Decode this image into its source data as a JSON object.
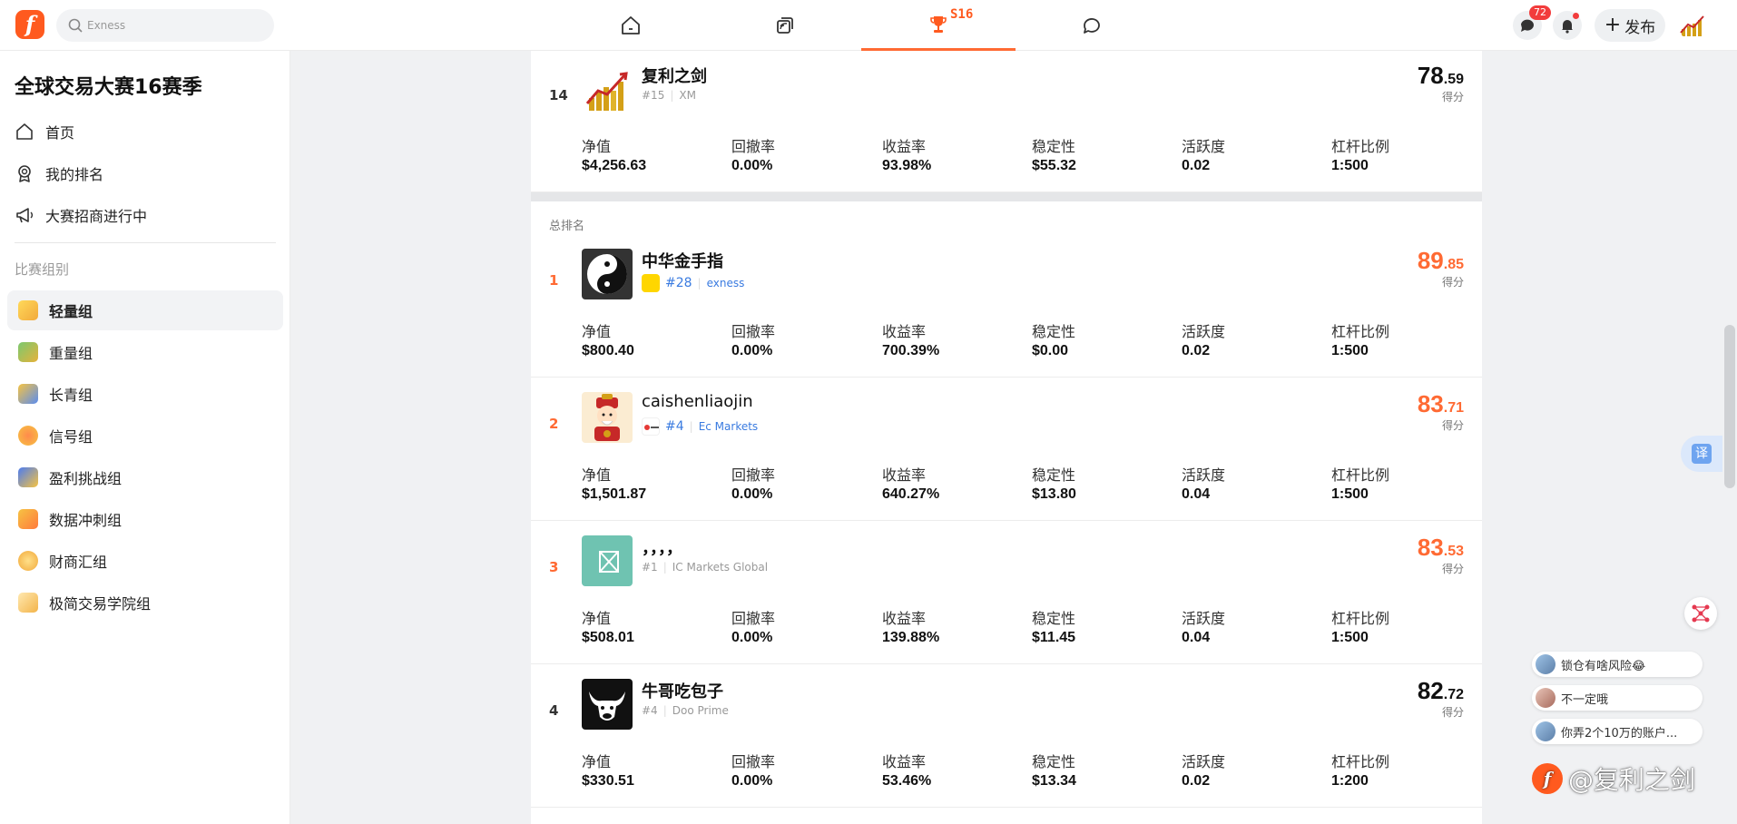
{
  "header": {
    "logo_letter": "f",
    "search_placeholder": "Exness",
    "contest_tag": "S16",
    "messages_badge": "72",
    "publish_label": "发布"
  },
  "sidebar": {
    "title": "全球交易大赛16赛季",
    "links": [
      {
        "label": "首页",
        "icon": "home-icon"
      },
      {
        "label": "我的排名",
        "icon": "award-icon"
      },
      {
        "label": "大赛招商进行中",
        "icon": "megaphone-icon"
      }
    ],
    "section_label": "比赛组别",
    "groups": [
      {
        "label": "轻量组",
        "active": true
      },
      {
        "label": "重量组",
        "active": false
      },
      {
        "label": "长青组",
        "active": false
      },
      {
        "label": "信号组",
        "active": false
      },
      {
        "label": "盈利挑战组",
        "active": false
      },
      {
        "label": "数据冲刺组",
        "active": false
      },
      {
        "label": "财商汇组",
        "active": false
      },
      {
        "label": "极简交易学院组",
        "active": false
      }
    ]
  },
  "stat_labels": {
    "equity": "净值",
    "drawdown": "回撤率",
    "return": "收益率",
    "stability": "稳定性",
    "activity": "活跃度",
    "leverage": "杠杆比例"
  },
  "score_label": "得分",
  "my_entry": {
    "rank": "14",
    "name": "复利之剑",
    "broker_rank": "#15",
    "broker": "XM",
    "score_int": "78",
    "score_dec": ".59",
    "equity": "$4,256.63",
    "drawdown": "0.00%",
    "return": "93.98%",
    "stability": "$55.32",
    "activity": "0.02",
    "leverage": "1:500"
  },
  "total_ranking_label": "总排名",
  "rankings": [
    {
      "rank": "1",
      "name": "中华金手指",
      "broker_rank": "#28",
      "broker": "exness",
      "score_int": "89",
      "score_dec": ".85",
      "equity": "$800.40",
      "drawdown": "0.00%",
      "return": "700.39%",
      "stability": "$0.00",
      "activity": "0.02",
      "leverage": "1:500"
    },
    {
      "rank": "2",
      "name": "caishenliaojin",
      "broker_rank": "#4",
      "broker": "Ec Markets",
      "score_int": "83",
      "score_dec": ".71",
      "equity": "$1,501.87",
      "drawdown": "0.00%",
      "return": "640.27%",
      "stability": "$13.80",
      "activity": "0.04",
      "leverage": "1:500"
    },
    {
      "rank": "3",
      "name": "，，，，",
      "broker_rank": "#1",
      "broker": "IC Markets Global",
      "score_int": "83",
      "score_dec": ".53",
      "equity": "$508.01",
      "drawdown": "0.00%",
      "return": "139.88%",
      "stability": "$11.45",
      "activity": "0.04",
      "leverage": "1:500"
    },
    {
      "rank": "4",
      "name": "牛哥吃包子",
      "broker_rank": "#4",
      "broker": "Doo Prime",
      "score_int": "82",
      "score_dec": ".72",
      "equity": "$330.51",
      "drawdown": "0.00%",
      "return": "53.46%",
      "stability": "$13.34",
      "activity": "0.02",
      "leverage": "1:200"
    }
  ],
  "floating": {
    "translate_label": "译",
    "comments": [
      "锁仓有啥风险😂",
      "不一定哦",
      "你弄2个10万的账户..."
    ],
    "watermark": "@复利之剑"
  },
  "colors": {
    "brand": "#ff5a1f",
    "accent_score": "#ff6a33",
    "link_blue": "#3a7be0"
  }
}
